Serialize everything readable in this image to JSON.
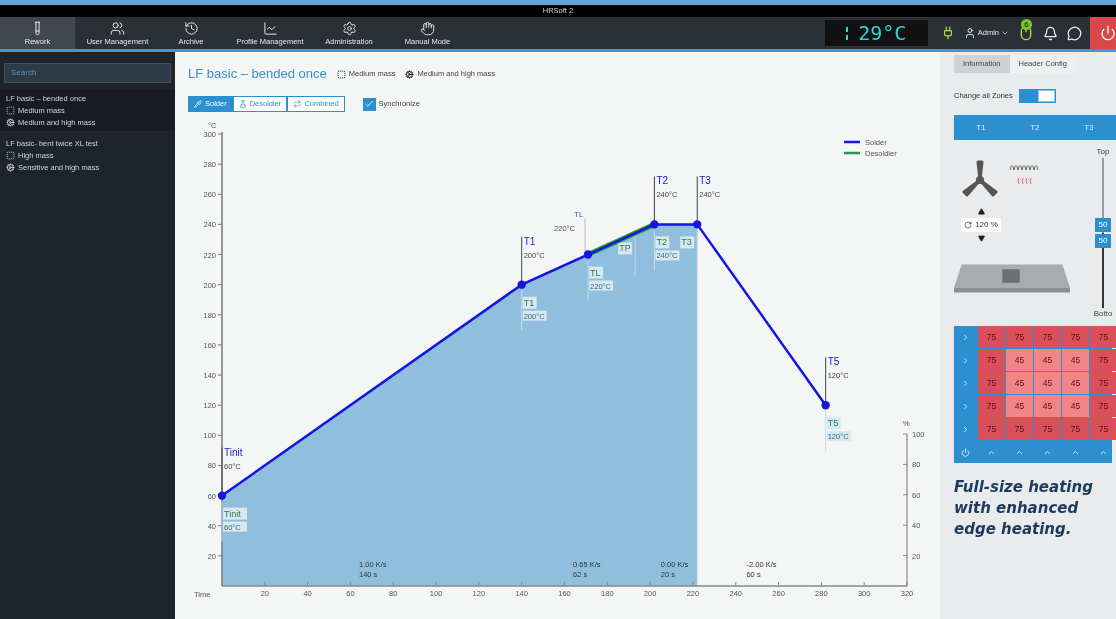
{
  "window": {
    "title": "HRSoft 2"
  },
  "nav": [
    {
      "label": "Rework",
      "selected": true
    },
    {
      "label": "User Management",
      "selected": false
    },
    {
      "label": "Archive",
      "selected": false
    },
    {
      "label": "Profile Management",
      "selected": false
    },
    {
      "label": "Administration",
      "selected": false
    },
    {
      "label": "Manual Mode",
      "selected": false
    }
  ],
  "status": {
    "temperature": "29°C",
    "user": "Admin",
    "badge": "6"
  },
  "sidebar": {
    "search": {
      "placeholder": "Search"
    },
    "groups": [
      {
        "title": "LF basic – bended once",
        "items": [
          "Medium mass",
          "Medium and high mass"
        ]
      },
      {
        "title": "LF basic- bent twice XL test",
        "items": [
          "High mass",
          "Sensitive and high mass"
        ]
      }
    ]
  },
  "profile": {
    "title": "LF basic – bended once",
    "tags": [
      "Medium mass",
      "Medium and high mass"
    ],
    "modes": [
      {
        "label": "Solder",
        "selected": true
      },
      {
        "label": "Desoldier",
        "selected": false
      },
      {
        "label": "Combined",
        "selected": false
      }
    ],
    "synchronize": {
      "label": "Synchronize",
      "checked": true
    },
    "chart_data": {
      "type": "line",
      "xlabel": "Time",
      "ylabel": "°C",
      "x": [
        0,
        140,
        171,
        202,
        222,
        282
      ],
      "series": [
        {
          "name": "Desoldier",
          "color": "#2e9a3a",
          "values": [
            null,
            null,
            220,
            240,
            null,
            null
          ]
        },
        {
          "name": "Solder",
          "color": "#1515e0",
          "marker": "circle",
          "values": [
            60,
            200,
            220,
            240,
            240,
            120
          ]
        }
      ],
      "legend": "upper right",
      "xlim": [
        0,
        320
      ],
      "ylim": [
        0,
        300
      ],
      "xticks": [
        20,
        40,
        60,
        80,
        100,
        120,
        140,
        160,
        180,
        200,
        220,
        240,
        260,
        280,
        300,
        320
      ],
      "yticks": [
        20,
        40,
        60,
        80,
        100,
        120,
        140,
        160,
        180,
        200,
        220,
        240,
        260,
        280,
        300
      ]
    },
    "percent_axis": {
      "label": "%",
      "ticks": [
        "100",
        "80",
        "60",
        "40",
        "20"
      ]
    },
    "point_labels": [
      {
        "kind": "above",
        "label": "Tinit",
        "value": "60°C"
      },
      {
        "kind": "above",
        "label": "T1",
        "value": "200°C"
      },
      {
        "kind": "side",
        "label": "TL",
        "value": "220°C"
      },
      {
        "kind": "above",
        "label": "T2",
        "value": "240°C"
      },
      {
        "kind": "above",
        "label": "T3",
        "value": "240°C"
      },
      {
        "kind": "above",
        "label": "T5",
        "value": "120°C"
      }
    ],
    "ghost_labels": [
      {
        "label": "Tinit",
        "value": "60°C"
      },
      {
        "label": "T1",
        "value": "200°C"
      },
      {
        "label": "TL",
        "value": "220°C"
      },
      {
        "label": "TP"
      },
      {
        "label": "T2",
        "value": "240°C"
      },
      {
        "label": "T3"
      },
      {
        "label": "T5",
        "value": "120°C"
      }
    ],
    "segment_labels": [
      {
        "rate": "1.00 K/s",
        "duration": "140 s"
      },
      {
        "rate": "0.65 K/s",
        "duration": "62 s"
      },
      {
        "rate": "0.00 K/s",
        "duration": "20 s"
      },
      {
        "rate": "-2.00 K/s",
        "duration": "60 s"
      }
    ]
  },
  "config": {
    "tabs": [
      {
        "label": "Information",
        "selected": false
      },
      {
        "label": "Header Config",
        "selected": true
      }
    ],
    "change_all_zones": {
      "label": "Change all Zones",
      "on": true
    },
    "zones": [
      "T1",
      "T2",
      "T3"
    ],
    "fan": {
      "value": "120 %"
    },
    "slider": {
      "top": "Top",
      "bottom": "Botto",
      "values": [
        "50",
        "50"
      ],
      "level": 0.5
    },
    "grid": [
      [
        {
          "value": "75",
          "color": "#d94f5a"
        },
        {
          "value": "75",
          "color": "#d94f5a"
        },
        {
          "value": "75",
          "color": "#d94f5a"
        },
        {
          "value": "75",
          "color": "#d94f5a"
        },
        {
          "value": "75",
          "color": "#d94f5a"
        }
      ],
      [
        {
          "value": "75",
          "color": "#d94f5a"
        },
        {
          "value": "45",
          "color": "#ef8585"
        },
        {
          "value": "45",
          "color": "#ef8585"
        },
        {
          "value": "45",
          "color": "#ef8585"
        },
        {
          "value": "75",
          "color": "#d94f5a"
        }
      ],
      [
        {
          "value": "75",
          "color": "#d94f5a"
        },
        {
          "value": "45",
          "color": "#ef8585"
        },
        {
          "value": "45",
          "color": "#ef8585"
        },
        {
          "value": "45",
          "color": "#ef8585"
        },
        {
          "value": "75",
          "color": "#d94f5a"
        }
      ],
      [
        {
          "value": "75",
          "color": "#d94f5a"
        },
        {
          "value": "45",
          "color": "#ef8585"
        },
        {
          "value": "45",
          "color": "#ef8585"
        },
        {
          "value": "45",
          "color": "#ef8585"
        },
        {
          "value": "75",
          "color": "#d94f5a"
        }
      ],
      [
        {
          "value": "75",
          "color": "#d94f5a"
        },
        {
          "value": "75",
          "color": "#d94f5a"
        },
        {
          "value": "75",
          "color": "#d94f5a"
        },
        {
          "value": "75",
          "color": "#d94f5a"
        },
        {
          "value": "75",
          "color": "#d94f5a"
        }
      ]
    ]
  },
  "caption": "Full-size heating with enhanced edge heating."
}
